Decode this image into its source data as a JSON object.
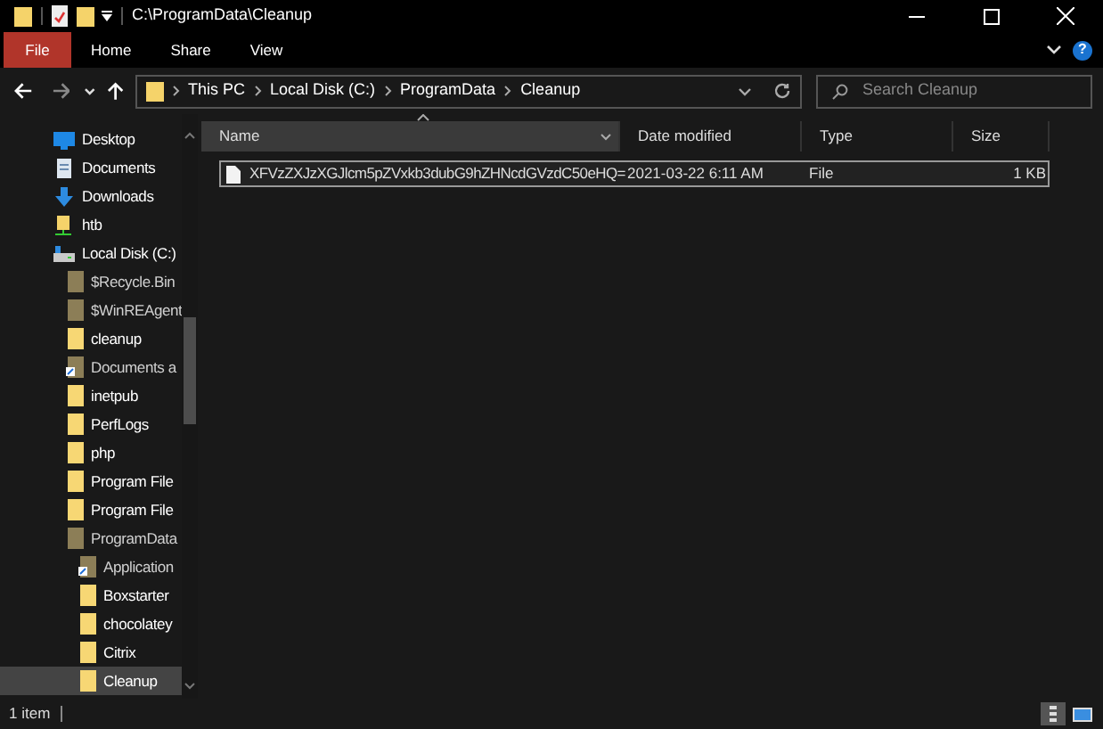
{
  "window": {
    "title": "C:\\ProgramData\\Cleanup"
  },
  "ribbon_tabs": [
    {
      "label": "File",
      "kind": "file",
      "selected": false
    },
    {
      "label": "Home",
      "kind": "tab",
      "selected": false
    },
    {
      "label": "Share",
      "kind": "tab",
      "selected": false
    },
    {
      "label": "View",
      "kind": "tab",
      "selected": false
    }
  ],
  "address_bar": {
    "crumbs": [
      "This PC",
      "Local Disk (C:)",
      "ProgramData",
      "Cleanup"
    ]
  },
  "search": {
    "placeholder": "Search Cleanup"
  },
  "help": {
    "label": "?"
  },
  "sidebar": {
    "items": [
      {
        "label": "Desktop",
        "kind": "desktop",
        "selected": false
      },
      {
        "label": "Documents",
        "kind": "documents",
        "selected": false
      },
      {
        "label": "Downloads",
        "kind": "downloads",
        "selected": false
      },
      {
        "label": "htb",
        "kind": "share",
        "selected": false
      },
      {
        "label": "Local Disk (C:)",
        "kind": "disk",
        "selected": false,
        "children": [
          {
            "label": "$Recycle.Bin",
            "kind": "folder",
            "hidden": true,
            "selected": false
          },
          {
            "label": "$WinREAgent",
            "kind": "folder",
            "hidden": true,
            "selected": false
          },
          {
            "label": "cleanup",
            "kind": "folder",
            "hidden": false,
            "selected": false
          },
          {
            "label": "Documents a",
            "kind": "link",
            "hidden": true,
            "selected": false
          },
          {
            "label": "inetpub",
            "kind": "folder",
            "hidden": false,
            "selected": false
          },
          {
            "label": "PerfLogs",
            "kind": "folder",
            "hidden": false,
            "selected": false
          },
          {
            "label": "php",
            "kind": "folder",
            "hidden": false,
            "selected": false
          },
          {
            "label": "Program File",
            "kind": "folder",
            "hidden": false,
            "selected": false
          },
          {
            "label": "Program File",
            "kind": "folder",
            "hidden": false,
            "selected": false
          },
          {
            "label": "ProgramData",
            "kind": "folder",
            "hidden": true,
            "selected": false,
            "children": [
              {
                "label": "Application",
                "kind": "link",
                "hidden": true,
                "selected": false
              },
              {
                "label": "Boxstarter",
                "kind": "folder",
                "hidden": false,
                "selected": false
              },
              {
                "label": "chocolatey",
                "kind": "folder",
                "hidden": false,
                "selected": false
              },
              {
                "label": "Citrix",
                "kind": "folder",
                "hidden": false,
                "selected": false
              },
              {
                "label": "Cleanup",
                "kind": "folder",
                "hidden": false,
                "selected": true
              }
            ]
          }
        ]
      }
    ]
  },
  "table": {
    "columns": [
      "Name",
      "Date modified",
      "Type",
      "Size"
    ],
    "rows": [
      {
        "name": "XFVzZXJzXGJlcm5pZVxkb3dubG9hZHNcdGVzdC50eHQ=",
        "date": "2021-03-22 6:11 AM",
        "type": "File",
        "size": "1 KB",
        "selected": true
      }
    ]
  },
  "status_bar": {
    "count": "1 item",
    "views": [
      {
        "kind": "details",
        "selected": true
      },
      {
        "kind": "tiles",
        "selected": false
      }
    ]
  }
}
